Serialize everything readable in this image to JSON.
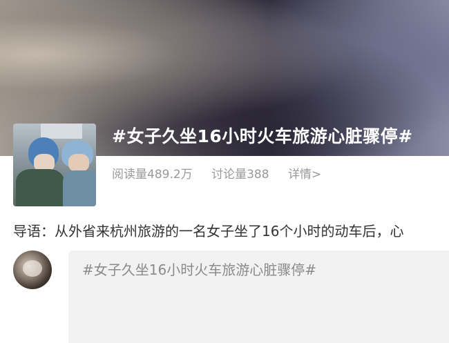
{
  "topic": {
    "title": "#女子久坐16小时火车旅游心脏骤停#",
    "stats": {
      "reads": "阅读量489.2万",
      "discussions": "讨论量388",
      "details": "详情>"
    }
  },
  "intro": {
    "text": "导语：从外省来杭州旅游的一名女子坐了16个小时的动车后，心"
  },
  "compose": {
    "text": "#女子久坐16小时火车旅游心脏骤停#"
  },
  "colors": {
    "title": "#ffffff",
    "stats": "#999999",
    "body_text": "#333333",
    "compose_bg": "#f2f2f2",
    "compose_text": "#8a8a8a"
  }
}
